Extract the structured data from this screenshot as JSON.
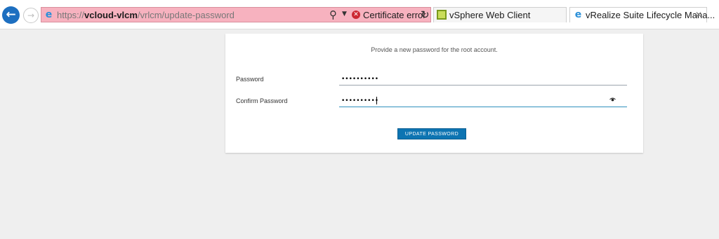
{
  "browser": {
    "url_prefix": "https://",
    "url_host": "vcloud-vlcm",
    "url_path": "/vrlcm/update-password",
    "certificate_error": "Certificate error",
    "tabs": [
      {
        "label": "vSphere Web Client",
        "icon": "vsphere-icon"
      },
      {
        "label": "vRealize Suite Lifecycle Mana...",
        "icon": "ie-icon",
        "active": true
      }
    ],
    "address_bar_color": "#f7b2bf"
  },
  "form": {
    "instruction": "Provide a new password for the root account.",
    "password_label": "Password",
    "password_value": "••••••••••",
    "confirm_label": "Confirm Password",
    "confirm_value": "••••••••••",
    "submit_label": "UPDATE PASSWORD",
    "button_color": "#0d74b2"
  }
}
